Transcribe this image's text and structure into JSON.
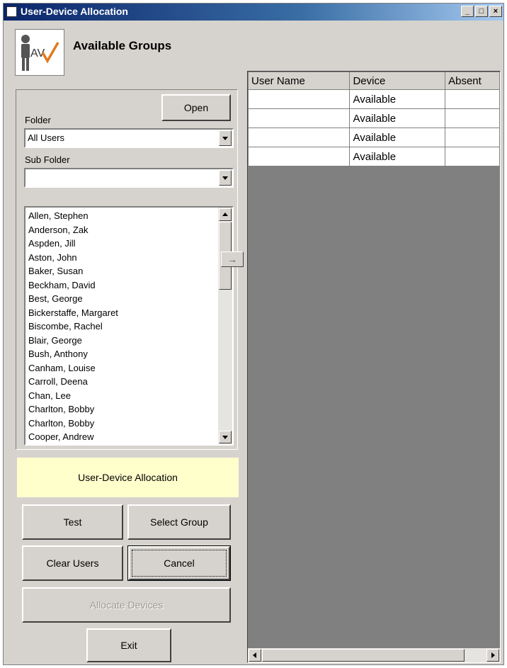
{
  "window": {
    "title": "User-Device Allocation",
    "controls": [
      "_",
      "□",
      "×"
    ]
  },
  "header": {
    "logo_text": "AV",
    "title": "Available Groups"
  },
  "filters": {
    "open_label": "Open",
    "folder_label": "Folder",
    "folder_value": "All Users",
    "subfolder_label": "Sub Folder",
    "subfolder_value": ""
  },
  "users": [
    "Allen, Stephen",
    "Anderson, Zak",
    "Aspden, Jill",
    "Aston, John",
    "Baker, Susan",
    "Beckham, David",
    "Best, George",
    "Bickerstaffe, Margaret",
    "Biscombe, Rachel",
    "Blair, George",
    "Bush, Anthony",
    "Canham, Louise",
    "Carroll, Deena",
    "Chan, Lee",
    "Charlton, Bobby",
    "Charlton, Bobby",
    "Cooper, Andrew"
  ],
  "move_button": "→",
  "status_panel": "User-Device Allocation",
  "buttons": {
    "test": "Test",
    "select_group": "Select Group",
    "clear_users": "Clear Users",
    "cancel": "Cancel",
    "allocate": "Allocate Devices",
    "exit": "Exit"
  },
  "grid": {
    "columns": [
      "User Name",
      "Device",
      "Absent"
    ],
    "rows": [
      [
        "",
        "Available",
        ""
      ],
      [
        "",
        "Available",
        ""
      ],
      [
        "",
        "Available",
        ""
      ],
      [
        "",
        "Available",
        ""
      ]
    ]
  },
  "colors": {
    "status_panel_bg": "#ffffcc",
    "title_bar": "#0a246a",
    "logo_check": "#e07a1f"
  }
}
